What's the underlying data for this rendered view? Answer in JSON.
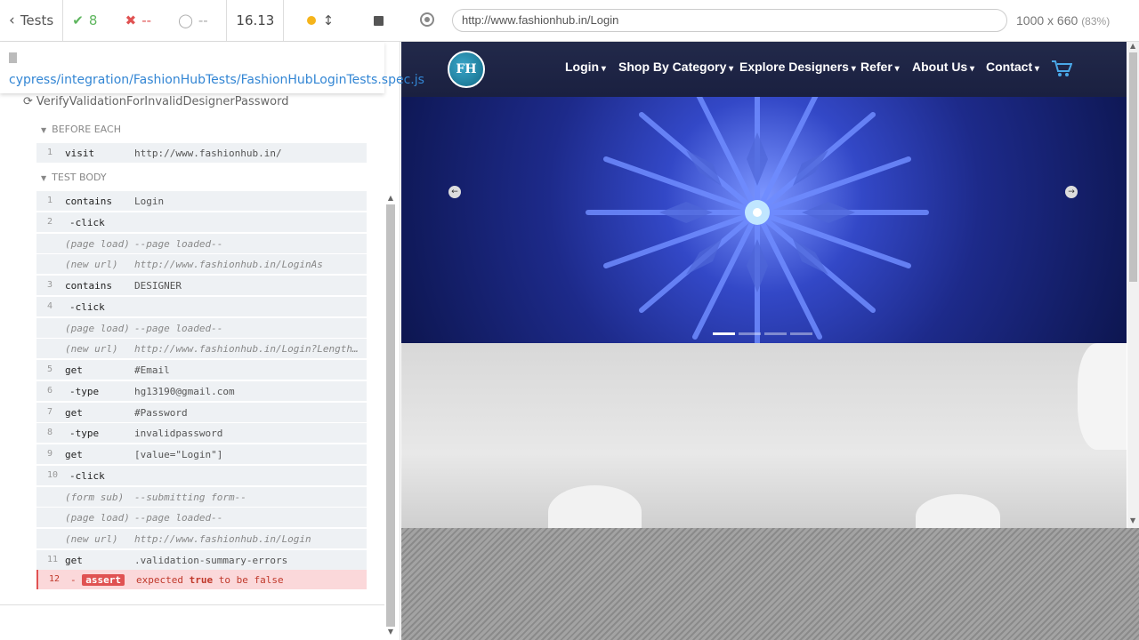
{
  "stats": {
    "tests_label": "Tests",
    "passed": "8",
    "failed": "--",
    "pending": "--",
    "duration": "16.13"
  },
  "spec": {
    "path": "cypress/integration/FashionHubTests/FashionHubLoginTests.spec.js"
  },
  "test": {
    "title": "VerifyValidationForInvalidDesignerPassword",
    "before_each_label": "BEFORE EACH",
    "test_body_label": "TEST BODY",
    "before_each": [
      {
        "num": "1",
        "name": "visit",
        "msg": "http://www.fashionhub.in/"
      }
    ],
    "body": [
      {
        "num": "1",
        "name": "contains",
        "msg": "Login"
      },
      {
        "num": "2",
        "name": "-click",
        "msg": ""
      },
      {
        "num": "",
        "name": "(page load)",
        "msg": "--page loaded--"
      },
      {
        "num": "",
        "name": "(new url)",
        "msg": "http://www.fashionhub.in/LoginAs"
      },
      {
        "num": "3",
        "name": "contains",
        "msg": "DESIGNER"
      },
      {
        "num": "4",
        "name": "-click",
        "msg": ""
      },
      {
        "num": "",
        "name": "(page load)",
        "msg": "--page loaded--"
      },
      {
        "num": "",
        "name": "(new url)",
        "msg": "http://www.fashionhub.in/Login?Length…"
      },
      {
        "num": "5",
        "name": "get",
        "msg": "#Email"
      },
      {
        "num": "6",
        "name": "-type",
        "msg": "hg13190@gmail.com"
      },
      {
        "num": "7",
        "name": "get",
        "msg": "#Password"
      },
      {
        "num": "8",
        "name": "-type",
        "msg": "invalidpassword"
      },
      {
        "num": "9",
        "name": "get",
        "msg": "[value=\"Login\"]"
      },
      {
        "num": "10",
        "name": "-click",
        "msg": ""
      },
      {
        "num": "",
        "name": "(form sub)",
        "msg": "--submitting form--"
      },
      {
        "num": "",
        "name": "(page load)",
        "msg": "--page loaded--"
      },
      {
        "num": "",
        "name": "(new url)",
        "msg": "http://www.fashionhub.in/Login"
      },
      {
        "num": "11",
        "name": "get",
        "msg": ".validation-summary-errors"
      }
    ],
    "assert": {
      "num": "12",
      "dash": "-",
      "badge": "assert",
      "msg_pre": "expected",
      "msg_val": "true",
      "msg_post": "to be false"
    }
  },
  "aut": {
    "url": "http://www.fashionhub.in/Login",
    "viewport": "1000 x 660",
    "scale": "(83%)",
    "logo_text": "FH",
    "nav": [
      "Login",
      "Shop By Category",
      "Explore Designers",
      "Refer",
      "About Us",
      "Contact"
    ]
  }
}
